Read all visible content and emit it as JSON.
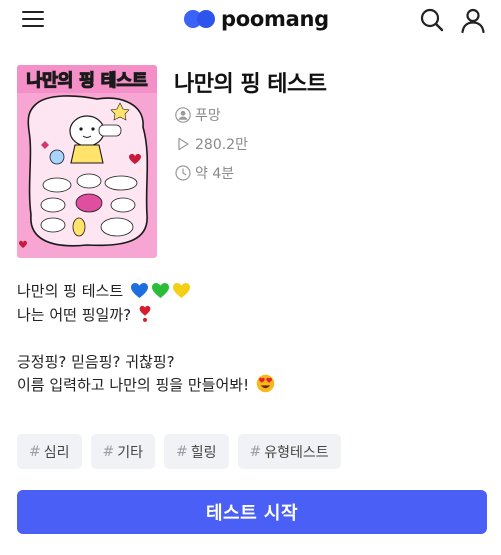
{
  "header": {
    "brand": "poomang",
    "menu_icon": "hamburger-menu-icon",
    "search_icon": "search-icon",
    "profile_icon": "user-profile-icon"
  },
  "test": {
    "thumbnail_alt": "나만의 핑 테스트 썸네일",
    "title": "나만의 핑 테스트",
    "author": "푸망",
    "plays": "280.2만",
    "duration": "약 4분"
  },
  "description": {
    "line1": "나만의 핑 테스트",
    "line2": "나는 어떤 핑일까?",
    "line3": "",
    "line4": "긍정핑? 믿음핑? 귀찮핑?",
    "line5": "이름 입력하고 나만의 핑을 만들어봐!"
  },
  "tags": [
    {
      "label": "심리"
    },
    {
      "label": "기타"
    },
    {
      "label": "힐링"
    },
    {
      "label": "유형테스트"
    }
  ],
  "tag_hash": "#",
  "start_button": "테스트 시작",
  "colors": {
    "brand": "#3b63f5",
    "start_button": "#4a5ff5",
    "thumbnail_bg": "#f7a6d3",
    "tag_bg": "#f0f2f5"
  }
}
